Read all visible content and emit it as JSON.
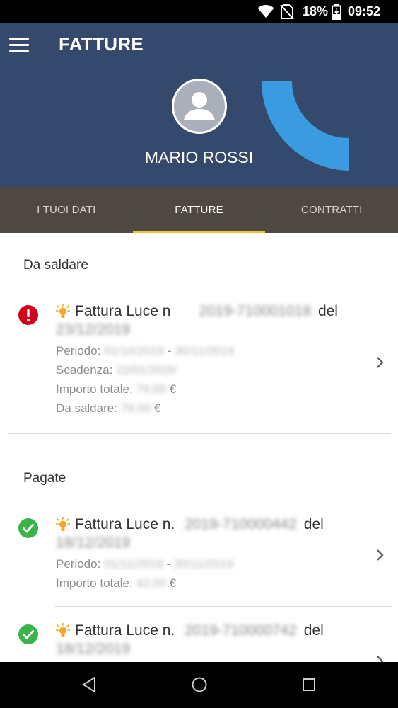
{
  "status_bar": {
    "battery": "18%",
    "time": "09:52",
    "icons": [
      "wifi-icon",
      "no-sim-icon",
      "battery-charging-icon"
    ]
  },
  "header": {
    "title": "FATTURE",
    "user_name": "MARIO ROSSI",
    "icons": [
      "menu-icon",
      "avatar-icon"
    ],
    "colors": {
      "background": "#34496c",
      "arc": "#3a9be0"
    }
  },
  "tabs": [
    {
      "label": "I TUOI DATI",
      "active": false
    },
    {
      "label": "FATTURE",
      "active": true
    },
    {
      "label": "CONTRATTI",
      "active": false
    }
  ],
  "tab_colors": {
    "bar": "#4f4741",
    "indicator": "#f2c230"
  },
  "sections": {
    "unpaid": {
      "title": "Da saldare",
      "invoices": [
        {
          "status": "error-icon",
          "title_prefix": "Fattura Luce n",
          "number": "2019-710001018",
          "del": "del",
          "date": "23/12/2019",
          "periodo_label": "Periodo:",
          "periodo_from": "01/10/2019",
          "periodo_sep": "-",
          "periodo_to": "30/11/2019",
          "scadenza_label": "Scadenza:",
          "scadenza": "22/01/2020",
          "importo_label": "Importo totale:",
          "importo": "79,00",
          "saldare_label": "Da saldare:",
          "saldare": "79,00",
          "currency": "€"
        }
      ]
    },
    "paid": {
      "title": "Pagate",
      "invoices": [
        {
          "status": "check-icon",
          "title_prefix": "Fattura Luce n.",
          "number": "2019-710000442",
          "del": "del",
          "date": "18/12/2019",
          "periodo_label": "Periodo:",
          "periodo_from": "01/11/2019",
          "periodo_sep": "-",
          "periodo_to": "30/11/2019",
          "importo_label": "Importo totale:",
          "importo": "42,00",
          "currency": "€"
        },
        {
          "status": "check-icon",
          "title_prefix": "Fattura Luce n.",
          "number": "2019-710000742",
          "del": "del",
          "date": "18/12/2019"
        }
      ]
    }
  },
  "status_colors": {
    "error": "#d0021b",
    "ok": "#39b44a",
    "bulb": "#f5a623"
  },
  "nav_bar": {
    "icons": [
      "back-icon",
      "home-icon",
      "recents-icon"
    ]
  }
}
